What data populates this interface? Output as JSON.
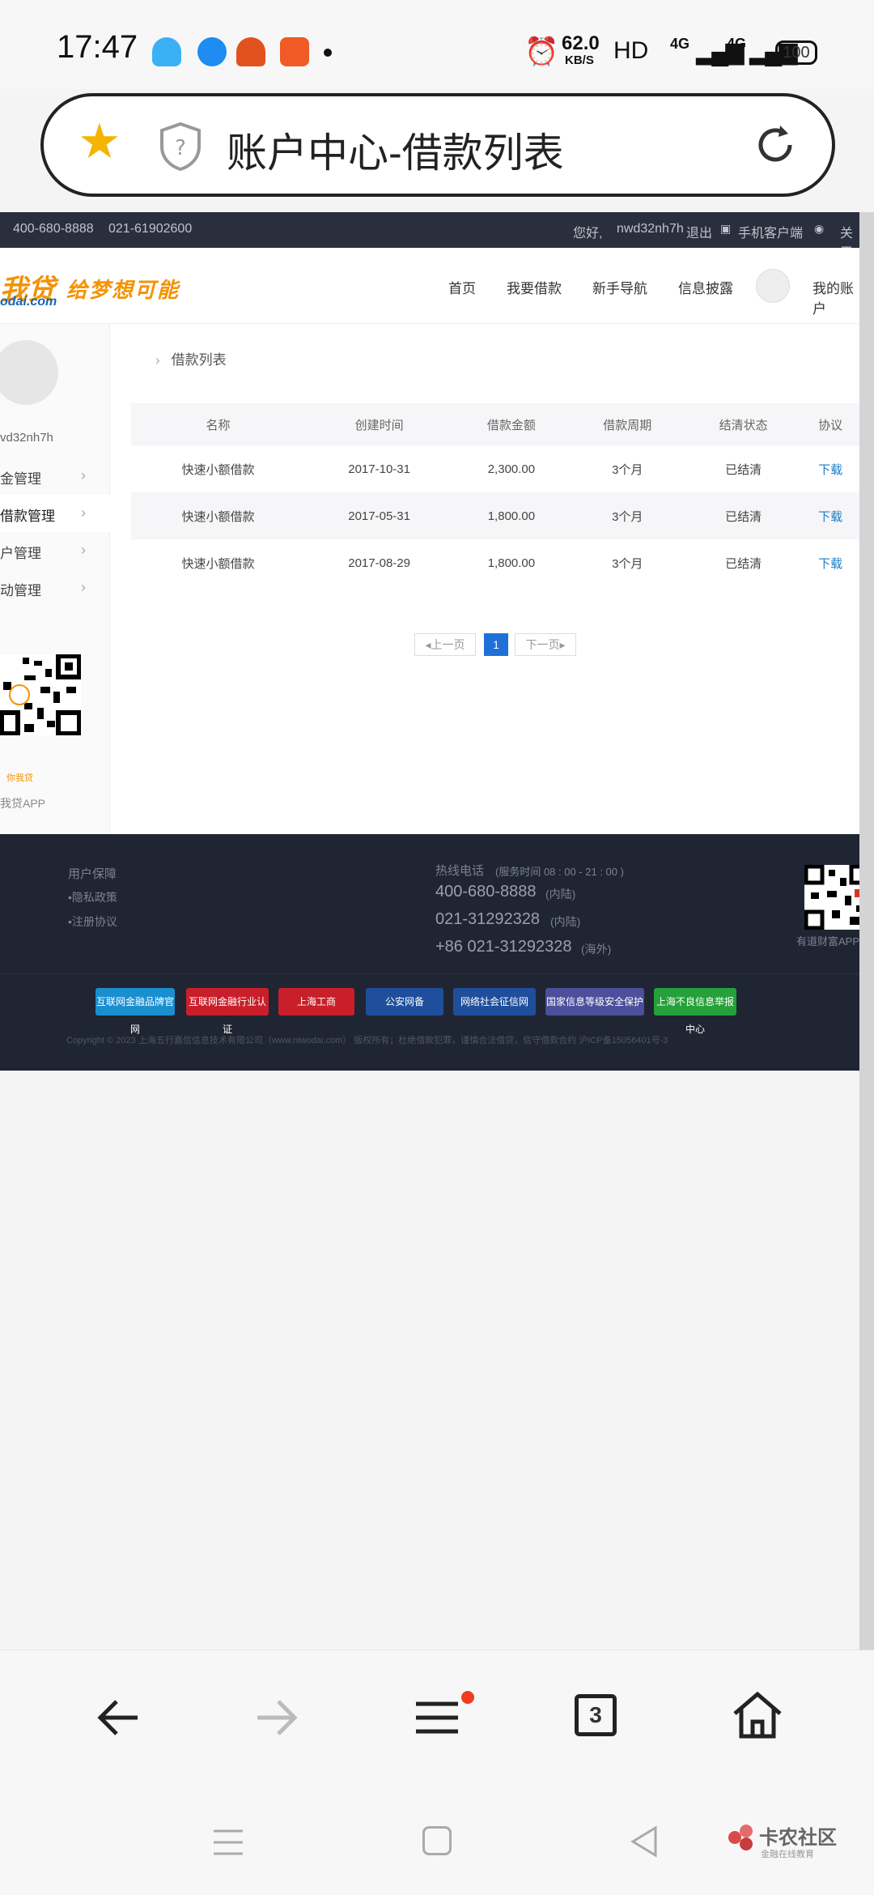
{
  "status_bar": {
    "time": "17:47",
    "net_speed": "62.0",
    "net_unit": "KB/S",
    "hd": "HD",
    "sig1": "4G",
    "sig2": "4G",
    "battery": "100"
  },
  "url_bar": {
    "title": "账户中心-借款列表"
  },
  "top_bar": {
    "phone1": "400-680-8888",
    "phone2": "021-61902600",
    "greeting": "您好,",
    "username": "nwd32nh7h",
    "logout": "退出",
    "mobile_client": "手机客户端",
    "about": "关于我"
  },
  "nav": {
    "logo_text": "我贷",
    "logo_sub": "odai.com",
    "slogan": "给梦想可能",
    "items": [
      "首页",
      "我要借款",
      "新手导航",
      "信息披露"
    ],
    "my_account": "我的账户"
  },
  "sidebar": {
    "username": "vd32nh7h",
    "items": [
      {
        "label": "金管理"
      },
      {
        "label": "借款管理"
      },
      {
        "label": "户管理"
      },
      {
        "label": "动管理"
      }
    ],
    "qr_brand": "你我贷",
    "app_label": "我贷APP"
  },
  "content": {
    "breadcrumb": "借款列表",
    "table": {
      "headers": [
        "名称",
        "创建时间",
        "借款金额",
        "借款周期",
        "结清状态",
        "协议"
      ],
      "rows": [
        [
          "快速小额借款",
          "2017-10-31",
          "2,300.00",
          "3个月",
          "已结清",
          "下载"
        ],
        [
          "快速小额借款",
          "2017-05-31",
          "1,800.00",
          "3个月",
          "已结清",
          "下载"
        ],
        [
          "快速小额借款",
          "2017-08-29",
          "1,800.00",
          "3个月",
          "已结清",
          "下载"
        ]
      ]
    },
    "pagination": {
      "prev": "上一页",
      "current": "1",
      "next": "下一页"
    }
  },
  "footer": {
    "guarantee": "用户保障",
    "privacy": "•隐私政策",
    "register": "•注册协议",
    "hotline_label": "热线电话",
    "service_hours": "(服务时间 08 : 00 - 21 : 00 )",
    "phone1": "400-680-8888",
    "phone1_note": "(内陆)",
    "phone2": "021-31292328",
    "phone2_note": "(内陆)",
    "phone3": "+86 021-31292328",
    "phone3_note": "(海外)",
    "qr_label": "有道财富APP",
    "badges": [
      "互联网金融品牌官网",
      "互联网金融行业认证",
      "上海工商",
      "公安网备",
      "网络社会征信网",
      "国家信息等级安全保护",
      "上海不良信息举报中心"
    ],
    "copyright": "Copyright © 2023 上海五行嘉信信息技术有限公司（www.niwodai.com）  版权所有；杜绝借款犯罪，谨慎合法借贷，信守借款合约  沪ICP备15056401号-3"
  },
  "toolbar": {
    "tab_count": "3"
  },
  "watermark": {
    "brand": "卡农社区",
    "sub": "金融在线教育"
  }
}
